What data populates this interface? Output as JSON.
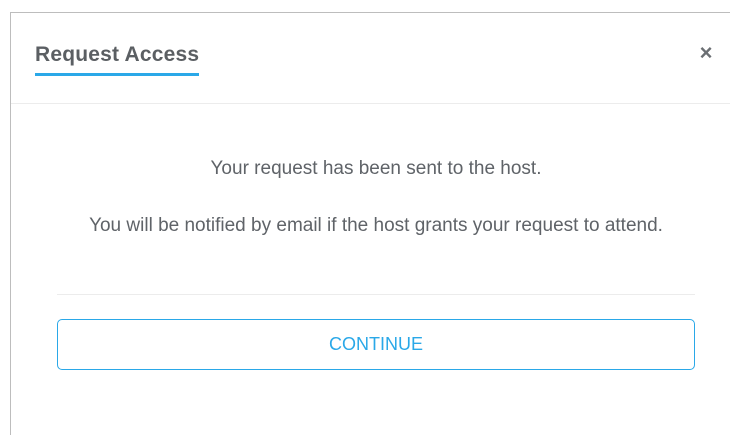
{
  "dialog": {
    "title": "Request Access",
    "close_label": "×",
    "message_1": "Your request has been sent to the host.",
    "message_2": "You will be notified by email if the host grants your request to attend.",
    "continue_label": "CONTINUE"
  },
  "colors": {
    "accent": "#2aa8e8",
    "text": "#5f6368",
    "divider": "#ececec"
  },
  "icons": {
    "close": "close-icon"
  }
}
